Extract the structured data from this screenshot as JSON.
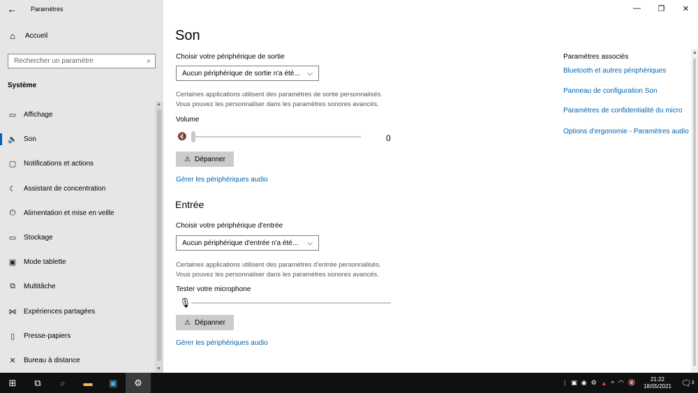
{
  "app": {
    "title": "Paramètres",
    "back_icon": "back-arrow-icon"
  },
  "sidebar": {
    "home_label": "Accueil",
    "search_placeholder": "Rechercher un paramètre",
    "section_label": "Système",
    "items": [
      {
        "label": "Affichage",
        "icon": "display-icon",
        "glyph": "▭"
      },
      {
        "label": "Son",
        "icon": "speaker-icon",
        "glyph": "🔈",
        "active": true
      },
      {
        "label": "Notifications et actions",
        "icon": "notification-icon",
        "glyph": "▢"
      },
      {
        "label": "Assistant de concentration",
        "icon": "moon-icon",
        "glyph": "☾"
      },
      {
        "label": "Alimentation et mise en veille",
        "icon": "power-icon",
        "glyph": "⏻"
      },
      {
        "label": "Stockage",
        "icon": "storage-icon",
        "glyph": "▭"
      },
      {
        "label": "Mode tablette",
        "icon": "tablet-icon",
        "glyph": "▣"
      },
      {
        "label": "Multitâche",
        "icon": "multitask-icon",
        "glyph": "⧉"
      },
      {
        "label": "Expériences partagées",
        "icon": "share-icon",
        "glyph": "⋈"
      },
      {
        "label": "Presse-papiers",
        "icon": "clipboard-icon",
        "glyph": "▯"
      },
      {
        "label": "Bureau à distance",
        "icon": "remote-icon",
        "glyph": "✕"
      }
    ]
  },
  "main": {
    "title": "Son",
    "output": {
      "label": "Choisir votre périphérique de sortie",
      "device": "Aucun périphérique de sortie n'a été...",
      "desc_line1": "Certaines applications utilisent des paramètres de sortie personnalisés.",
      "desc_line2": "Vous pouvez les personnaliser dans les paramètres sonores avancés.",
      "volume_label": "Volume",
      "volume_value": "0",
      "volume_level": 0,
      "troubleshoot": "Dépanner",
      "manage_link": "Gérer les périphériques audio"
    },
    "input": {
      "heading": "Entrée",
      "label": "Choisir votre périphérique d'entrée",
      "device": "Aucun périphérique d'entrée n'a été...",
      "desc_line1": "Certaines applications utilisent des paramètres d'entrée personnalisés.",
      "desc_line2": "Vous pouvez les personnaliser dans les paramètres sonores avancés.",
      "mic_label": "Tester votre microphone",
      "mic_level": 0,
      "troubleshoot": "Dépanner",
      "manage_link": "Gérer les périphériques audio"
    },
    "related": {
      "title": "Paramètres associés",
      "links": [
        "Bluetooth et autres périphériques",
        "Panneau de configuration Son",
        "Paramètres de confidentialité du micro",
        "Options d'ergonomie - Paramètres audio"
      ]
    }
  },
  "taskbar": {
    "time": "21:22",
    "date": "18/05/2021",
    "notification_count": "3"
  },
  "colors": {
    "accent": "#0063b1",
    "sidebar_bg": "#e6e6e6",
    "taskbar_bg": "#101010"
  }
}
